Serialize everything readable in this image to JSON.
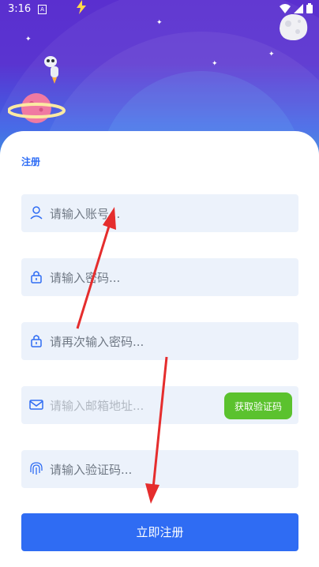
{
  "status_bar": {
    "time": "3:16",
    "sim_label": "A",
    "icons": [
      "lightning-icon",
      "wifi-icon",
      "signal-icon",
      "battery-icon"
    ]
  },
  "form": {
    "title": "注册",
    "account_placeholder": "请输入账号...",
    "password_placeholder": "请输入密码...",
    "password_confirm_placeholder": "请再次输入密码...",
    "email_placeholder": "请输入邮箱地址...",
    "get_code_label": "获取验证码",
    "code_placeholder": "请输入验证码...",
    "submit_label": "立即注册"
  },
  "colors": {
    "accent": "#2f6cf3",
    "code_button": "#5bc22e",
    "field_bg": "#ecf2fb",
    "arrow": "#e52d2d"
  }
}
